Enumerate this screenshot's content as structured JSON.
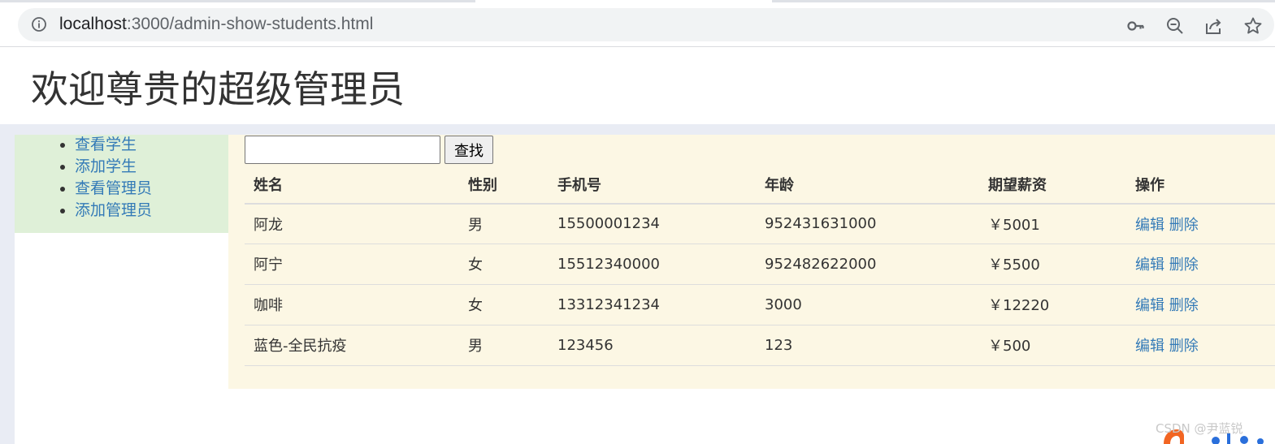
{
  "browser": {
    "url_host": "localhost",
    "url_path": ":3000/admin-show-students.html",
    "icons": [
      "info-icon",
      "key-icon",
      "zoom-out-icon",
      "share-icon",
      "bookmark-star-icon"
    ]
  },
  "header": {
    "title": "欢迎尊贵的超级管理员"
  },
  "sidebar": {
    "items": [
      {
        "label": "查看学生"
      },
      {
        "label": "添加学生"
      },
      {
        "label": "查看管理员"
      },
      {
        "label": "添加管理员"
      }
    ]
  },
  "search": {
    "value": "",
    "placeholder": "",
    "button_label": "查找"
  },
  "table": {
    "columns": [
      "姓名",
      "性别",
      "手机号",
      "年龄",
      "期望薪资",
      "操作"
    ],
    "rows": [
      {
        "name": "阿龙",
        "gender": "男",
        "phone": "15500001234",
        "age": "952431631000",
        "salary": "￥5001",
        "edit": "编辑",
        "delete": "删除"
      },
      {
        "name": "阿宁",
        "gender": "女",
        "phone": "15512340000",
        "age": "952482622000",
        "salary": "￥5500",
        "edit": "编辑",
        "delete": "删除"
      },
      {
        "name": "咖啡",
        "gender": "女",
        "phone": "13312341234",
        "age": "3000",
        "salary": "￥12220",
        "edit": "编辑",
        "delete": "删除"
      },
      {
        "name": "蓝色-全民抗疫",
        "gender": "男",
        "phone": "123456",
        "age": "123",
        "salary": "￥500",
        "edit": "编辑",
        "delete": "删除"
      }
    ]
  },
  "watermark": "CSDN @尹蓝锐",
  "colors": {
    "link": "#337ab7",
    "sidebar_bg": "#dff0d8",
    "main_bg": "#fcf7e4",
    "band_bg": "#e9ecf4"
  }
}
